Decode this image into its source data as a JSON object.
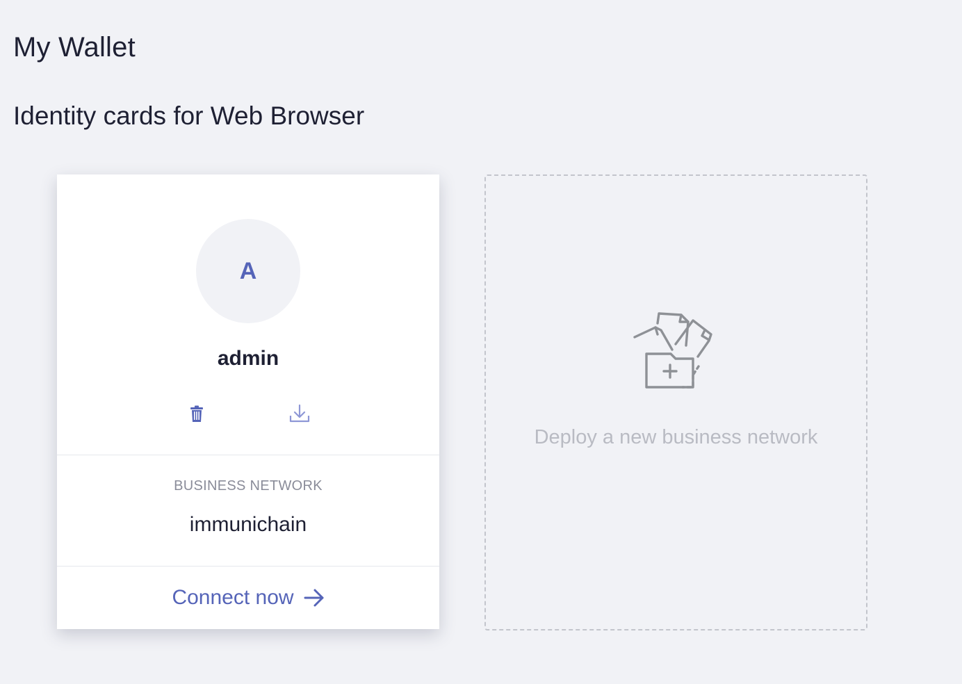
{
  "header": {
    "title": "My Wallet",
    "subtitle": "Identity cards for Web Browser"
  },
  "identity_card": {
    "avatar_initial": "A",
    "name": "admin",
    "delete_icon": "trash-icon",
    "export_icon": "download-icon",
    "network_label": "BUSINESS NETWORK",
    "network_name": "immunichain",
    "connect_label": "Connect now",
    "connect_icon": "arrow-right-icon"
  },
  "deploy_card": {
    "icon": "folder-plus-icon",
    "label": "Deploy a new business network"
  },
  "colors": {
    "background": "#f1f2f6",
    "accent": "#5564b8",
    "muted_text": "#b9bbc3",
    "icon_gray": "#8e9196"
  }
}
